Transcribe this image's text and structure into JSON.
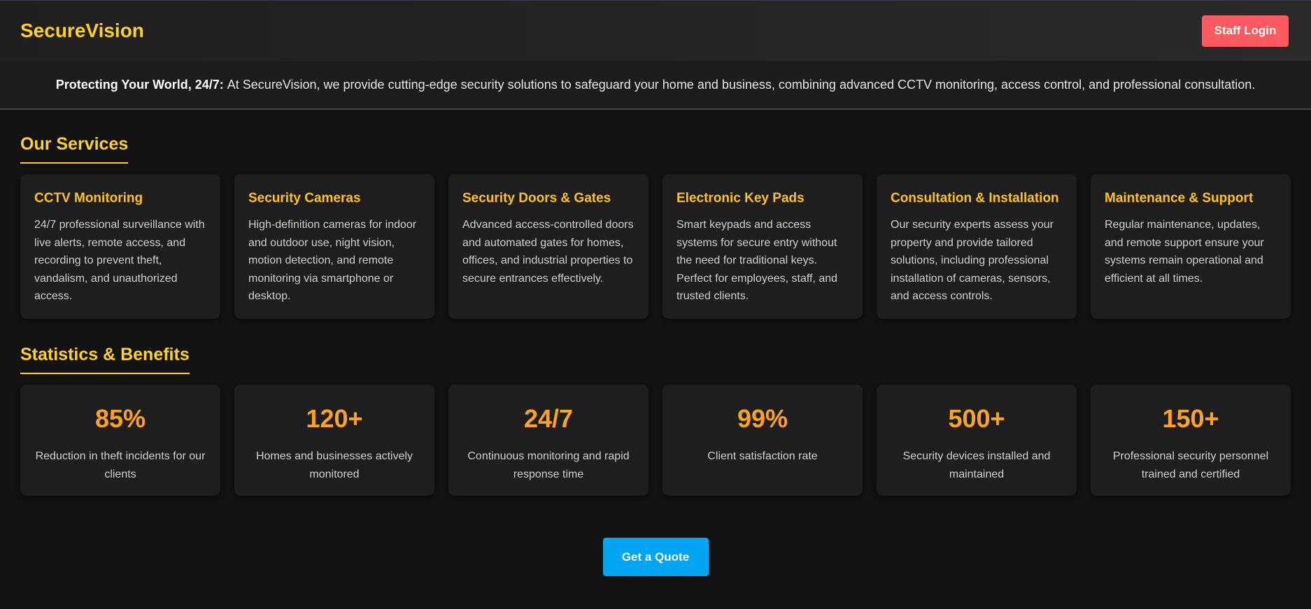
{
  "header": {
    "brand": "SecureVision",
    "staff_login_label": "Staff Login"
  },
  "intro": {
    "lead": "Protecting Your World, 24/7:",
    "text": "At SecureVision, we provide cutting-edge security solutions to safeguard your home and business, combining advanced CCTV monitoring, access control, and professional consultation."
  },
  "services": {
    "title": "Our Services",
    "items": [
      {
        "title": "CCTV Monitoring",
        "desc": "24/7 professional surveillance with live alerts, remote access, and recording to prevent theft, vandalism, and unauthorized access."
      },
      {
        "title": "Security Cameras",
        "desc": "High-definition cameras for indoor and outdoor use, night vision, motion detection, and remote monitoring via smartphone or desktop."
      },
      {
        "title": "Security Doors & Gates",
        "desc": "Advanced access-controlled doors and automated gates for homes, offices, and industrial properties to secure entrances effectively."
      },
      {
        "title": "Electronic Key Pads",
        "desc": "Smart keypads and access systems for secure entry without the need for traditional keys. Perfect for employees, staff, and trusted clients."
      },
      {
        "title": "Consultation & Installation",
        "desc": "Our security experts assess your property and provide tailored solutions, including professional installation of cameras, sensors, and access controls."
      },
      {
        "title": "Maintenance & Support",
        "desc": "Regular maintenance, updates, and remote support ensure your systems remain operational and efficient at all times."
      }
    ]
  },
  "stats": {
    "title": "Statistics & Benefits",
    "items": [
      {
        "value": "85%",
        "label": "Reduction in theft incidents for our clients"
      },
      {
        "value": "120+",
        "label": "Homes and businesses actively monitored"
      },
      {
        "value": "24/7",
        "label": "Continuous monitoring and rapid response time"
      },
      {
        "value": "99%",
        "label": "Client satisfaction rate"
      },
      {
        "value": "500+",
        "label": "Security devices installed and maintained"
      },
      {
        "value": "150+",
        "label": "Professional security personnel trained and certified"
      }
    ]
  },
  "cta": {
    "quote_label": "Get a Quote"
  },
  "colors": {
    "brand_yellow": "#ffd21f",
    "stat_orange": "#ffa31a",
    "staff_login_red": "#ff5a5f",
    "quote_blue": "#00a5f2",
    "background": "#121212"
  }
}
